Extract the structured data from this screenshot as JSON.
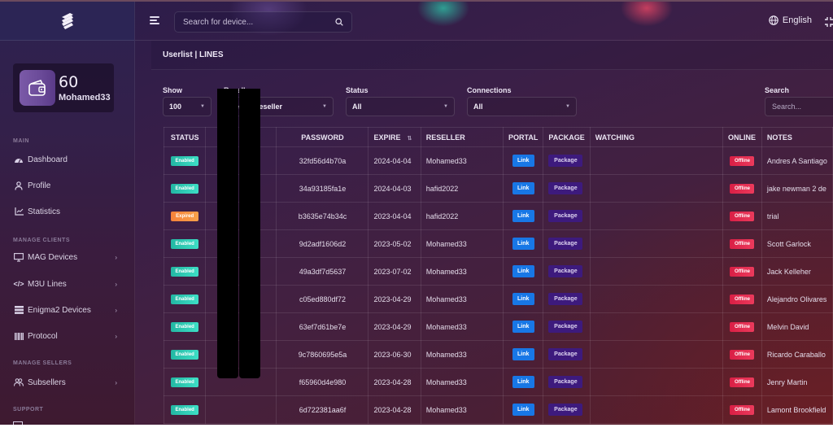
{
  "topbar": {
    "search_placeholder": "Search for device...",
    "language": "English"
  },
  "wallet": {
    "amount": "60",
    "username": "Mohamed33"
  },
  "sidebar": {
    "sections": [
      {
        "title": "MAIN"
      },
      {
        "title": "MANAGE CLIENTS"
      },
      {
        "title": "MANAGE SELLERS"
      },
      {
        "title": "SUPPORT"
      }
    ],
    "items": [
      {
        "label": "Dashboard",
        "icon": "dashboard-icon"
      },
      {
        "label": "Profile",
        "icon": "user-icon"
      },
      {
        "label": "Statistics",
        "icon": "chart-icon"
      },
      {
        "label": "MAG Devices",
        "icon": "monitor-icon",
        "has_submenu": true
      },
      {
        "label": "M3U Lines",
        "icon": "code-icon",
        "has_submenu": true
      },
      {
        "label": "Enigma2 Devices",
        "icon": "server-icon",
        "has_submenu": true
      },
      {
        "label": "Protocol",
        "icon": "barcode-icon",
        "has_submenu": true
      },
      {
        "label": "Subsellers",
        "icon": "users-icon",
        "has_submenu": true
      }
    ]
  },
  "page": {
    "title": "Userlist | LINES"
  },
  "filters": {
    "show": {
      "label": "Show",
      "value": "100"
    },
    "reseller": {
      "label": "Reseller",
      "value": "Select Reseller"
    },
    "status": {
      "label": "Status",
      "value": "All"
    },
    "connections": {
      "label": "Connections",
      "value": "All"
    },
    "search": {
      "label": "Search",
      "placeholder": "Search..."
    }
  },
  "table": {
    "columns": [
      "STATUS",
      "",
      "PASSWORD",
      "EXPIRE",
      "RESELLER",
      "PORTAL",
      "PACKAGE",
      "WATCHING",
      "ONLINE",
      "NOTES"
    ],
    "link_label": "Link",
    "package_label": "Package",
    "rows": [
      {
        "status": "Enabled",
        "password": "32fd56d4b70a",
        "expire": "2024-04-04",
        "reseller": "Mohamed33",
        "online": "Offline",
        "notes": "Andres A Santiago"
      },
      {
        "status": "Enabled",
        "password": "34a93185fa1e",
        "expire": "2024-04-03",
        "reseller": "hafid2022",
        "online": "Offline",
        "notes": "jake newman 2 de"
      },
      {
        "status": "Expired",
        "password": "b3635e74b34c",
        "expire": "2023-04-04",
        "reseller": "hafid2022",
        "online": "Offline",
        "notes": "trial"
      },
      {
        "status": "Enabled",
        "password": "9d2adf1606d2",
        "expire": "2023-05-02",
        "reseller": "Mohamed33",
        "online": "Offline",
        "notes": "Scott Garlock"
      },
      {
        "status": "Enabled",
        "password": "49a3df7d5637",
        "expire": "2023-07-02",
        "reseller": "Mohamed33",
        "online": "Offline",
        "notes": "Jack Kelleher"
      },
      {
        "status": "Enabled",
        "password": "c05ed880df72",
        "expire": "2023-04-29",
        "reseller": "Mohamed33",
        "online": "Offline",
        "notes": "Alejandro Olivares"
      },
      {
        "status": "Enabled",
        "password": "63ef7d61be7e",
        "expire": "2023-04-29",
        "reseller": "Mohamed33",
        "online": "Offline",
        "notes": "Melvin David"
      },
      {
        "status": "Enabled",
        "password": "9c7860695e5a",
        "expire": "2023-06-30",
        "reseller": "Mohamed33",
        "online": "Offline",
        "notes": "Ricardo Caraballo"
      },
      {
        "status": "Enabled",
        "password": "f65960d4e980",
        "expire": "2023-04-28",
        "reseller": "Mohamed33",
        "online": "Offline",
        "notes": "Jenry Martin"
      },
      {
        "status": "Enabled",
        "password": "6d722381aa6f",
        "expire": "2023-04-28",
        "reseller": "Mohamed33",
        "online": "Offline",
        "notes": "Lamont Brookfield"
      }
    ]
  },
  "colors": {
    "enabled": "#2fcdb5",
    "expired": "#f6913f",
    "offline": "#e32d50",
    "link": "#1877e6",
    "package": "#3d1a7d"
  }
}
